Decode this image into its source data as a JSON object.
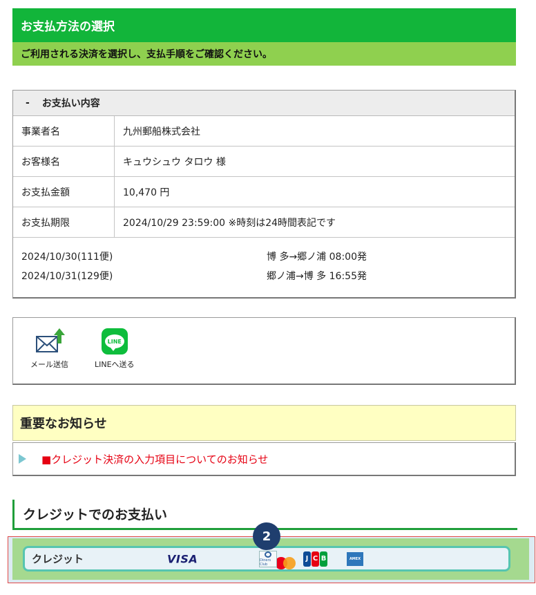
{
  "header": {
    "title": "お支払方法の選択",
    "subtitle": "ご利用される決済を選択し、支払手順をご確認ください。"
  },
  "payment_details": {
    "section_title": "お支払い内容",
    "rows": [
      {
        "label": "事業者名",
        "value": "九州郵船株式会社"
      },
      {
        "label": "お客様名",
        "value": "キュウシュウ タロウ 様"
      },
      {
        "label": "お支払金額",
        "value": "10,470 円"
      },
      {
        "label": "お支払期限",
        "value": "2024/10/29 23:59:00 ※時刻は24時間表記です"
      }
    ],
    "trips": [
      {
        "date": "2024/10/30(111便)",
        "route": "博 多→郷ノ浦 08:00発"
      },
      {
        "date": "2024/10/31(129便)",
        "route": "郷ノ浦→博 多 16:55発"
      }
    ]
  },
  "share": {
    "mail_label": "メール送信",
    "line_label": "LINEへ送る",
    "line_icon_text": "LINE"
  },
  "notice": {
    "title": "重要なお知らせ",
    "link_text": "■クレジット決済の入力項目についてのお知らせ"
  },
  "credit": {
    "section_title": "クレジットでのお支払い",
    "button_label": "クレジット",
    "brands": {
      "visa": "VISA",
      "jcb": [
        "J",
        "C",
        "B"
      ],
      "diners": "Diners Club"
    }
  },
  "badge": {
    "number": "2"
  },
  "colors": {
    "header_green": "#12b53a",
    "sub_green": "#8fd04f",
    "notice_yellow": "#ffffc2",
    "link_red": "#e60012",
    "badge_navy": "#1f3e6e"
  }
}
